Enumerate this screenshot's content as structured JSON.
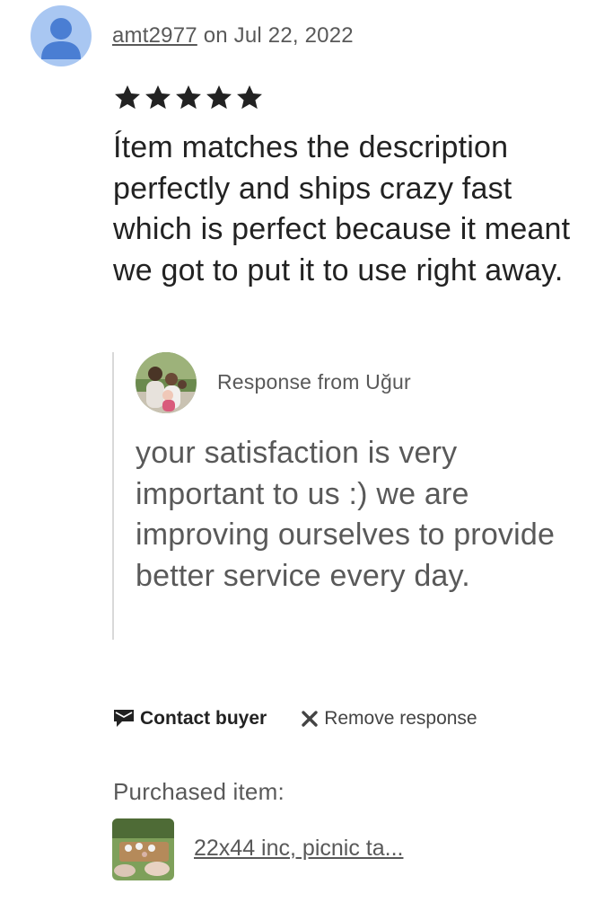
{
  "review": {
    "username": "amt2977",
    "date_text": "on Jul 22, 2022",
    "rating": 5,
    "stars_text": "★★★★★",
    "text": "Ítem matches the description perfectly and ships crazy fast which is perfect because it meant we got to put it to use right away."
  },
  "response": {
    "label": "Response from Uğur",
    "text": "your satisfaction is very important to us :) we are improving ourselves to provide better service every day."
  },
  "actions": {
    "contact_label": "Contact buyer",
    "remove_label": "Remove response"
  },
  "purchase": {
    "label": "Purchased item:",
    "item_name": "22x44 inc, picnic ta..."
  },
  "colors": {
    "avatar_bg": "#a9c7f2",
    "avatar_fg": "#4a7ed3",
    "text_primary": "#222222",
    "text_secondary": "#595959",
    "divider": "#d9d9d9"
  },
  "icons": {
    "avatar": "user-silhouette-icon",
    "star": "star-icon",
    "contact": "message-icon",
    "remove": "close-icon"
  }
}
